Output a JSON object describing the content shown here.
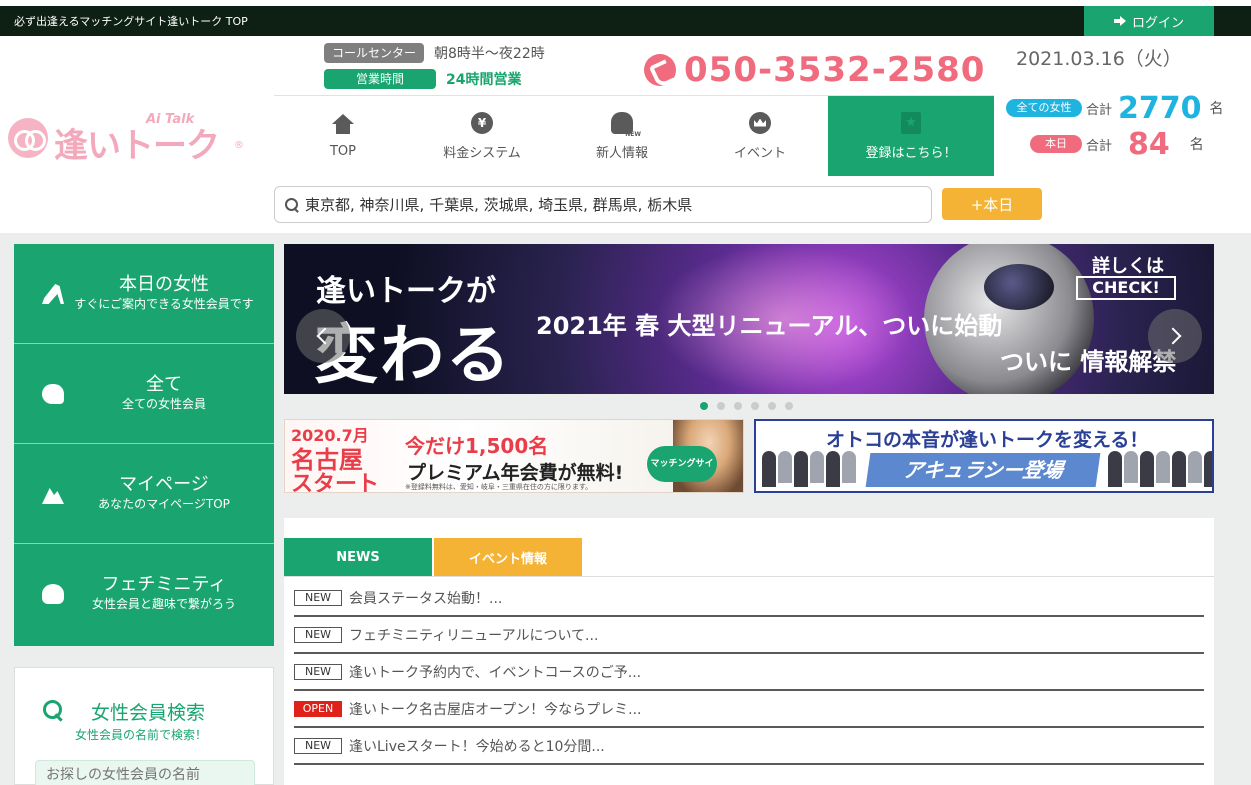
{
  "topbar": {
    "tagline": "必ず出逢えるマッチングサイト逢いトーク TOP",
    "login_label": "ログイン"
  },
  "logo": {
    "name": "逢いトーク",
    "sub": "Ai Talk",
    "registered": "®"
  },
  "hours": {
    "call_center_label": "コールセンター",
    "call_center_hours": "朝8時半〜夜22時",
    "business_label": "営業時間",
    "business_hours": "24時間営業"
  },
  "phone": {
    "number": "050-3532-2580"
  },
  "date": "2021.03.16（火）",
  "nav": {
    "items": [
      {
        "label": "TOP",
        "icon": "home-icon"
      },
      {
        "label": "料金システム",
        "icon": "yen-icon"
      },
      {
        "label": "新人情報",
        "icon": "new-girl-icon"
      },
      {
        "label": "イベント",
        "icon": "crown-icon"
      },
      {
        "label": "登録はこちら！",
        "icon": "register-icon"
      }
    ]
  },
  "counts": {
    "all_label": "全ての女性",
    "all_total_label": "合計",
    "all_value": "2770",
    "all_unit": "名",
    "today_label": "本日",
    "today_total_label": "合計",
    "today_value": "84",
    "today_unit": "名"
  },
  "search": {
    "value": "東京都, 神奈川県, 千葉県, 茨城県, 埼玉県, 群馬県, 栃木県",
    "today_button": "+本日"
  },
  "sidebar": {
    "items": [
      {
        "title": "本日の女性",
        "sub": "すぐにご案内できる女性会員です",
        "icon": "high-heel-icon"
      },
      {
        "title": "全て",
        "sub": "全ての女性会員",
        "icon": "woman-silhouette-icon"
      },
      {
        "title": "マイページ",
        "sub": "あなたのマイページTOP",
        "icon": "mountain-icon"
      },
      {
        "title": "フェチミニティ",
        "sub": "女性会員と趣味で繋がろう",
        "icon": "community-icon"
      }
    ],
    "member_search": {
      "title": "女性会員検索",
      "sub": "女性会員の名前で検索！",
      "placeholder": "お探しの女性会員の名前"
    }
  },
  "hero": {
    "line1": "逢いトークが",
    "line2": "変わる",
    "line3": "2021年 春 大型リニューアル、ついに始動",
    "line4": "ついに 情報解禁",
    "check_top": "詳しくは",
    "check_btn": "CHECK!"
  },
  "banner1": {
    "date": "2020.7月",
    "city": "名古屋",
    "start": "スタート",
    "promo": "今だけ1,500名",
    "premium": "プレミアム年会費が無料!",
    "note": "※登録料無料は、愛知・岐阜・三重県在住の方に限ります。",
    "stamp": "マッチングサイト"
  },
  "banner2": {
    "headline": "オトコの本音が逢いトークを変える！",
    "sub": "アキュラシー登場"
  },
  "news": {
    "tabs": [
      {
        "label": "NEWS"
      },
      {
        "label": "イベント情報"
      }
    ],
    "items": [
      {
        "badge": "NEW",
        "text": "会員ステータス始動！..."
      },
      {
        "badge": "NEW",
        "text": "フェチミニティリニューアルについて..."
      },
      {
        "badge": "NEW",
        "text": "逢いトーク予約内で、イベントコースのご予..."
      },
      {
        "badge": "OPEN",
        "text": "逢いトーク名古屋店オープン！今ならプレミ..."
      },
      {
        "badge": "NEW",
        "text": "逢いLiveスタート！今始めると10分間..."
      }
    ]
  },
  "colors": {
    "brand_green": "#1aa570",
    "accent_pink": "#ef6b7d",
    "accent_blue": "#1fb3df",
    "accent_orange": "#f5b335"
  }
}
